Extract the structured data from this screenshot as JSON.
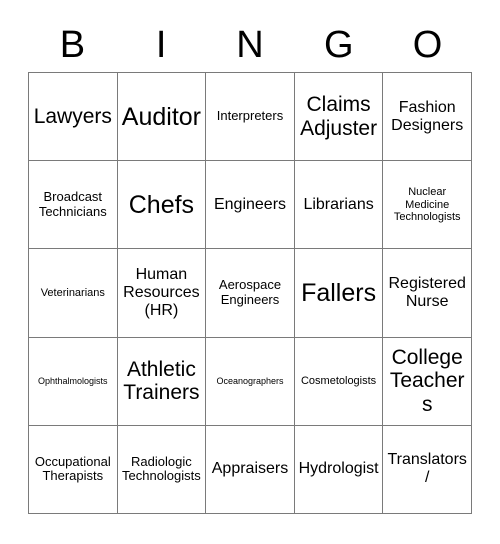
{
  "card": {
    "header_letters": [
      "B",
      "I",
      "N",
      "G",
      "O"
    ],
    "columns": 5,
    "rows": 5,
    "border_color": "#7a7a7a",
    "text_color": "#000000",
    "background_color": "#ffffff",
    "cells": [
      {
        "text": "Lawyers",
        "size": "lg"
      },
      {
        "text": "Auditor",
        "size": "xl"
      },
      {
        "text": "Interpreters",
        "size": "sm"
      },
      {
        "text": "Claims Adjuster",
        "size": "lg"
      },
      {
        "text": "Fashion Designers",
        "size": "md"
      },
      {
        "text": "Broadcast Technicians",
        "size": "sm"
      },
      {
        "text": "Chefs",
        "size": "xl"
      },
      {
        "text": "Engineers",
        "size": "md"
      },
      {
        "text": "Librarians",
        "size": "md"
      },
      {
        "text": "Nuclear Medicine Technologists",
        "size": "xs"
      },
      {
        "text": "Veterinarians",
        "size": "xs"
      },
      {
        "text": "Human Resources (HR)",
        "size": "md"
      },
      {
        "text": "Aerospace Engineers",
        "size": "sm"
      },
      {
        "text": "Fallers",
        "size": "xl"
      },
      {
        "text": "Registered Nurse",
        "size": "md"
      },
      {
        "text": "Ophthalmologists",
        "size": "xxs"
      },
      {
        "text": "Athletic Trainers",
        "size": "lg"
      },
      {
        "text": "Oceanographers",
        "size": "xxs"
      },
      {
        "text": "Cosmetologists",
        "size": "xs"
      },
      {
        "text": "College Teachers",
        "size": "lg"
      },
      {
        "text": "Occupational Therapists",
        "size": "sm"
      },
      {
        "text": "Radiologic Technologists",
        "size": "sm"
      },
      {
        "text": "Appraisers",
        "size": "md"
      },
      {
        "text": "Hydrologist",
        "size": "md"
      },
      {
        "text": "Translators/",
        "size": "md"
      }
    ]
  }
}
